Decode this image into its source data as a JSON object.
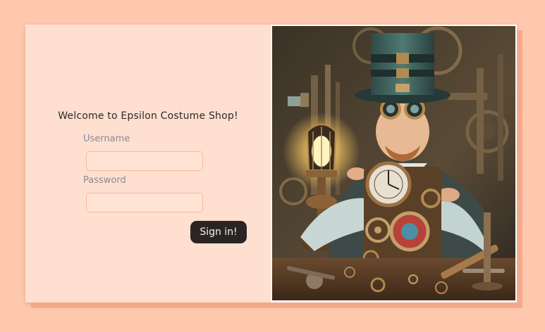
{
  "form": {
    "welcome": "Welcome to Epsilon Costume Shop!",
    "username_label": "Username",
    "username_value": "",
    "password_label": "Password",
    "password_value": "",
    "signin_label": "Sign in!"
  },
  "illustration": {
    "subject": "steampunk-clockmaker-illustration"
  },
  "colors": {
    "page_background": "#fdc8ae",
    "card_background": "#ffdfcf",
    "input_border": "#f7b898",
    "button_background": "#2a2524",
    "button_text": "#f3f3f3"
  }
}
